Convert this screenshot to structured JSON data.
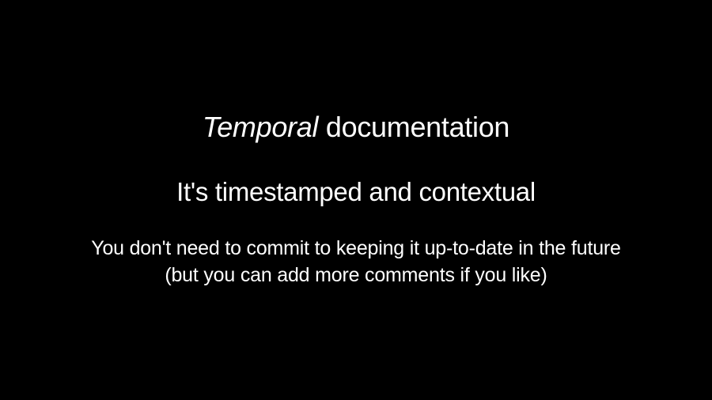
{
  "slide": {
    "title_italic": "Temporal",
    "title_rest": " documentation",
    "subtitle": "It's timestamped and contextual",
    "body_line1": "You don't need to commit to keeping it up-to-date in the future",
    "body_line2": "(but you can add more comments if you like)"
  }
}
